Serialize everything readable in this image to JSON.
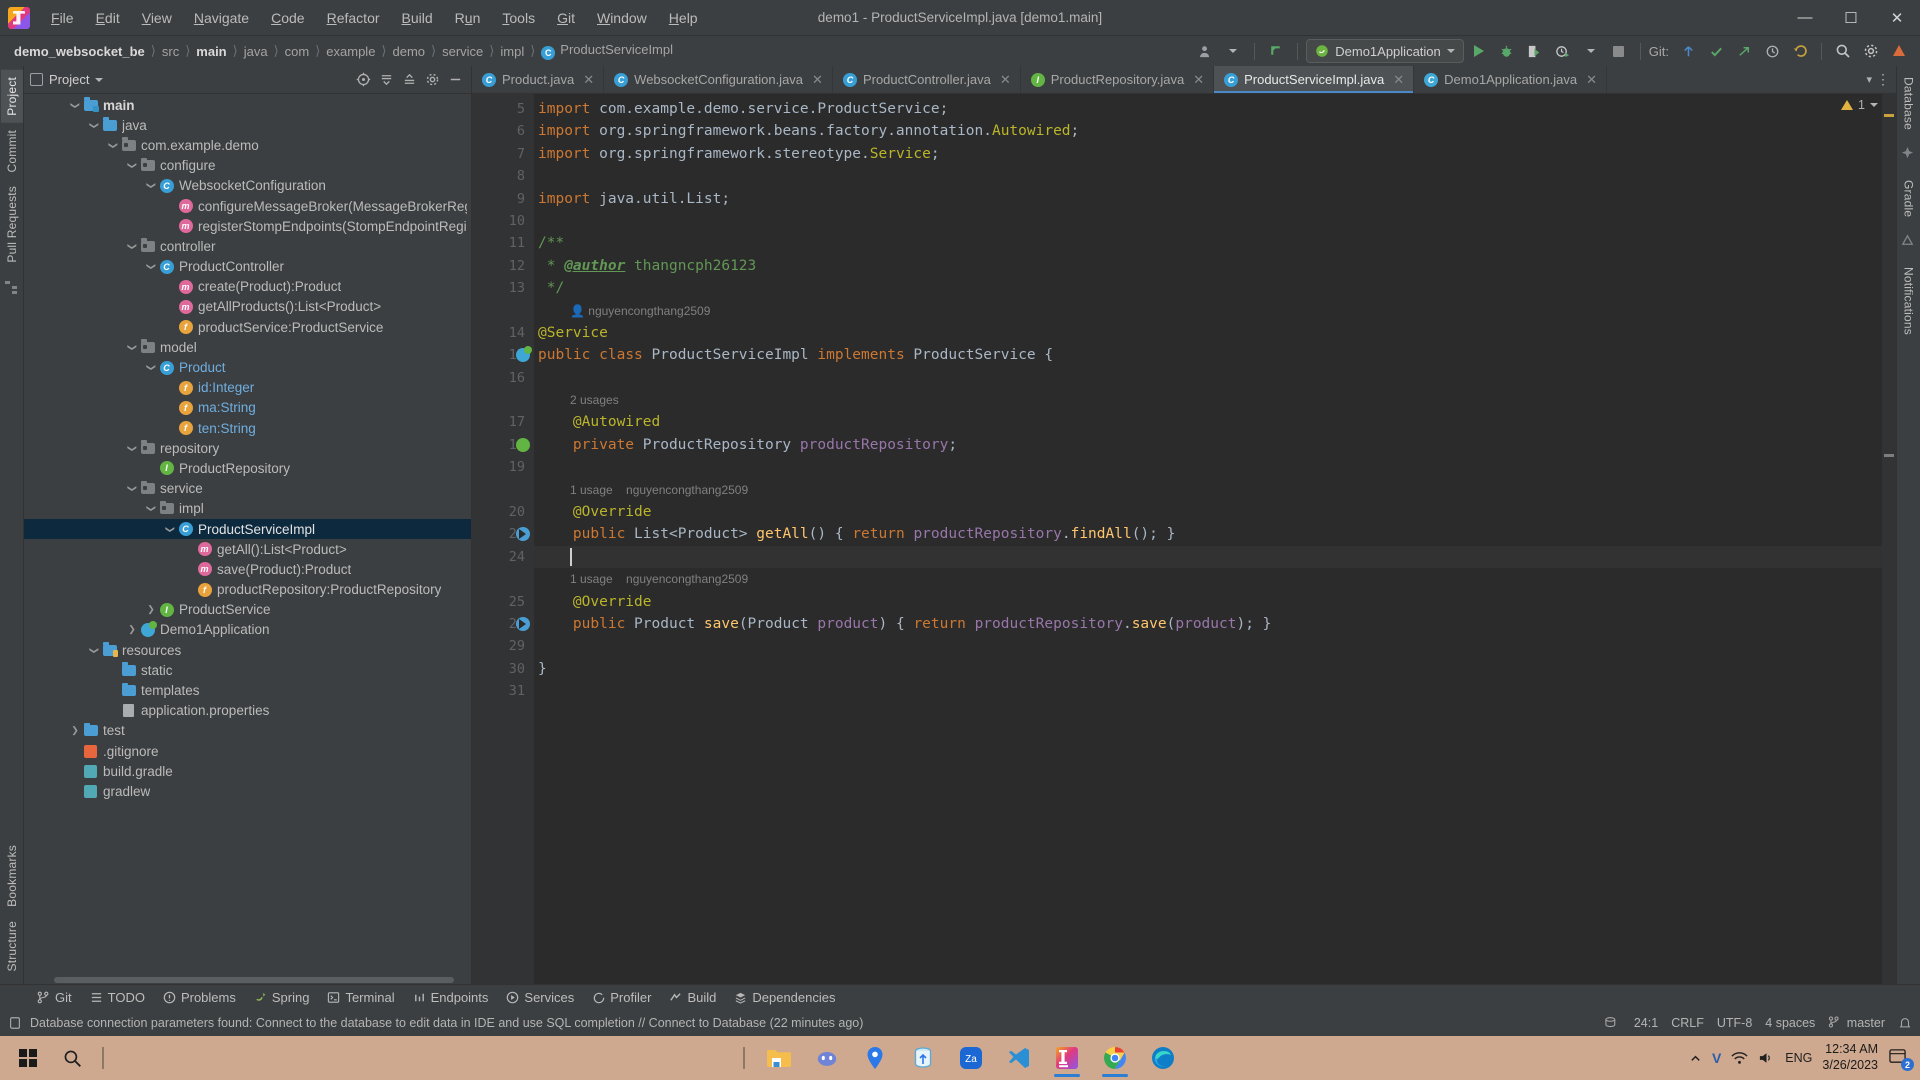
{
  "window": {
    "title": "demo1 - ProductServiceImpl.java [demo1.main]",
    "minimize_label": "—",
    "maximize_label": "❐",
    "close_label": "✕"
  },
  "menubar": [
    {
      "label": "File",
      "mnemonic": "F"
    },
    {
      "label": "Edit",
      "mnemonic": "E"
    },
    {
      "label": "View",
      "mnemonic": "V"
    },
    {
      "label": "Navigate",
      "mnemonic": "N"
    },
    {
      "label": "Code",
      "mnemonic": "C"
    },
    {
      "label": "Refactor",
      "mnemonic": "R"
    },
    {
      "label": "Build",
      "mnemonic": "B"
    },
    {
      "label": "Run",
      "mnemonic": "u"
    },
    {
      "label": "Tools",
      "mnemonic": "T"
    },
    {
      "label": "Git",
      "mnemonic": "G"
    },
    {
      "label": "Window",
      "mnemonic": "W"
    },
    {
      "label": "Help",
      "mnemonic": "H"
    }
  ],
  "breadcrumb": [
    {
      "label": "demo_websocket_be",
      "bold": true
    },
    {
      "label": "src",
      "bold": false
    },
    {
      "label": "main",
      "bold": true
    },
    {
      "label": "java",
      "bold": false
    },
    {
      "label": "com",
      "bold": false
    },
    {
      "label": "example",
      "bold": false
    },
    {
      "label": "demo",
      "bold": false
    },
    {
      "label": "service",
      "bold": false
    },
    {
      "label": "impl",
      "bold": false
    },
    {
      "label": "ProductServiceImpl",
      "bold": false,
      "icon": "C"
    }
  ],
  "toolbar": {
    "run_configuration": "Demo1Application",
    "git_label": "Git:",
    "run_button": "run-icon",
    "debug_button": "debug-icon",
    "coverage_button": "coverage-icon",
    "profile_button": "profile-icon",
    "stop_button": "stop-icon",
    "search_button": "search-icon",
    "settings_button": "settings-icon",
    "user_button": "user-icon",
    "updates_button": "update-icon"
  },
  "left_rail": {
    "tabs": [
      "Project",
      "Commit",
      "Pull Requests"
    ],
    "bottom_tabs": [
      "Bookmarks",
      "Structure"
    ],
    "active": "Project"
  },
  "right_rail": {
    "tabs": [
      "Database",
      "Gradle",
      "Notifications"
    ]
  },
  "project_panel": {
    "title": "Project",
    "tree": [
      {
        "indent": 2,
        "label": "main",
        "icon": "folder-src",
        "arrow": "down",
        "bold": true,
        "blue": false
      },
      {
        "indent": 3,
        "label": "java",
        "icon": "folder-blue",
        "arrow": "down",
        "bold": false,
        "blue": false
      },
      {
        "indent": 4,
        "label": "com.example.demo",
        "icon": "folder-pkg",
        "arrow": "down",
        "bold": false,
        "blue": false
      },
      {
        "indent": 5,
        "label": "configure",
        "icon": "folder-pkg",
        "arrow": "down",
        "bold": false,
        "blue": false
      },
      {
        "indent": 6,
        "label": "WebsocketConfiguration",
        "icon": "class",
        "arrow": "down",
        "bold": false,
        "blue": false
      },
      {
        "indent": 7,
        "label": "configureMessageBroker(MessageBrokerRegistry):v",
        "icon": "method",
        "arrow": "none",
        "bold": false,
        "blue": false
      },
      {
        "indent": 7,
        "label": "registerStompEndpoints(StompEndpointRegistry):v",
        "icon": "method",
        "arrow": "none",
        "bold": false,
        "blue": false
      },
      {
        "indent": 5,
        "label": "controller",
        "icon": "folder-pkg",
        "arrow": "down",
        "bold": false,
        "blue": false
      },
      {
        "indent": 6,
        "label": "ProductController",
        "icon": "class",
        "arrow": "down",
        "bold": false,
        "blue": false
      },
      {
        "indent": 7,
        "label": "create(Product):Product",
        "icon": "method",
        "arrow": "none",
        "bold": false,
        "blue": false
      },
      {
        "indent": 7,
        "label": "getAllProducts():List<Product>",
        "icon": "method",
        "arrow": "none",
        "bold": false,
        "blue": false
      },
      {
        "indent": 7,
        "label": "productService:ProductService",
        "icon": "field",
        "arrow": "none",
        "bold": false,
        "blue": false
      },
      {
        "indent": 5,
        "label": "model",
        "icon": "folder-pkg",
        "arrow": "down",
        "bold": false,
        "blue": false
      },
      {
        "indent": 6,
        "label": "Product",
        "icon": "class",
        "arrow": "down",
        "bold": false,
        "blue": true
      },
      {
        "indent": 7,
        "label": "id:Integer",
        "icon": "field",
        "arrow": "none",
        "bold": false,
        "blue": true
      },
      {
        "indent": 7,
        "label": "ma:String",
        "icon": "field",
        "arrow": "none",
        "bold": false,
        "blue": true
      },
      {
        "indent": 7,
        "label": "ten:String",
        "icon": "field",
        "arrow": "none",
        "bold": false,
        "blue": true
      },
      {
        "indent": 5,
        "label": "repository",
        "icon": "folder-pkg",
        "arrow": "down",
        "bold": false,
        "blue": false
      },
      {
        "indent": 6,
        "label": "ProductRepository",
        "icon": "interface",
        "arrow": "none",
        "bold": false,
        "blue": false
      },
      {
        "indent": 5,
        "label": "service",
        "icon": "folder-pkg",
        "arrow": "down",
        "bold": false,
        "blue": false
      },
      {
        "indent": 6,
        "label": "impl",
        "icon": "folder-pkg",
        "arrow": "down",
        "bold": false,
        "blue": false
      },
      {
        "indent": 7,
        "label": "ProductServiceImpl",
        "icon": "class",
        "arrow": "down",
        "bold": false,
        "blue": false,
        "selected": true
      },
      {
        "indent": 8,
        "label": "getAll():List<Product>",
        "icon": "method",
        "arrow": "none",
        "bold": false,
        "blue": false
      },
      {
        "indent": 8,
        "label": "save(Product):Product",
        "icon": "method",
        "arrow": "none",
        "bold": false,
        "blue": false
      },
      {
        "indent": 8,
        "label": "productRepository:ProductRepository",
        "icon": "field",
        "arrow": "none",
        "bold": false,
        "blue": false
      },
      {
        "indent": 6,
        "label": "ProductService",
        "icon": "interface",
        "arrow": "right",
        "bold": false,
        "blue": false
      },
      {
        "indent": 5,
        "label": "Demo1Application",
        "icon": "spring",
        "arrow": "right",
        "bold": false,
        "blue": false
      },
      {
        "indent": 3,
        "label": "resources",
        "icon": "folder-res",
        "arrow": "down",
        "bold": false,
        "blue": false
      },
      {
        "indent": 4,
        "label": "static",
        "icon": "folder-blue",
        "arrow": "none",
        "bold": false,
        "blue": false
      },
      {
        "indent": 4,
        "label": "templates",
        "icon": "folder-blue",
        "arrow": "none",
        "bold": false,
        "blue": false
      },
      {
        "indent": 4,
        "label": "application.properties",
        "icon": "props",
        "arrow": "none",
        "bold": false,
        "blue": false
      },
      {
        "indent": 2,
        "label": "test",
        "icon": "folder-test",
        "arrow": "right",
        "bold": false,
        "blue": false
      },
      {
        "indent": 2,
        "label": ".gitignore",
        "icon": "git",
        "arrow": "none",
        "bold": false,
        "blue": false
      },
      {
        "indent": 2,
        "label": "build.gradle",
        "icon": "gradle",
        "arrow": "none",
        "bold": false,
        "blue": false
      },
      {
        "indent": 2,
        "label": "gradlew",
        "icon": "gradle",
        "arrow": "none",
        "bold": false,
        "blue": false
      }
    ]
  },
  "editor_tabs": [
    {
      "label": "Product.java",
      "icon": "class",
      "active": false
    },
    {
      "label": "WebsocketConfiguration.java",
      "icon": "class",
      "active": false
    },
    {
      "label": "ProductController.java",
      "icon": "class",
      "active": false
    },
    {
      "label": "ProductRepository.java",
      "icon": "interface",
      "active": false
    },
    {
      "label": "ProductServiceImpl.java",
      "icon": "class",
      "active": true
    },
    {
      "label": "Demo1Application.java",
      "icon": "spring",
      "active": false
    }
  ],
  "editor": {
    "filename": "ProductServiceImpl.java",
    "inspection_count": "1",
    "lines": [
      {
        "num": "5",
        "type": "code",
        "text": "import com.example.demo.service.ProductService;"
      },
      {
        "num": "6",
        "type": "code",
        "text": "import org.springframework.beans.factory.annotation.Autowired;"
      },
      {
        "num": "7",
        "type": "code",
        "text": "import org.springframework.stereotype.Service;"
      },
      {
        "num": "8",
        "type": "code",
        "text": ""
      },
      {
        "num": "9",
        "type": "code",
        "text": "import java.util.List;"
      },
      {
        "num": "10",
        "type": "code",
        "text": ""
      },
      {
        "num": "11",
        "type": "code",
        "text": "/**"
      },
      {
        "num": "12",
        "type": "code",
        "text": " * @author thangncph26123"
      },
      {
        "num": "13",
        "type": "code",
        "text": " */"
      },
      {
        "num": "",
        "type": "hint",
        "text": "nguyencongthang2509"
      },
      {
        "num": "14",
        "type": "code",
        "text": "@Service"
      },
      {
        "num": "15",
        "type": "code",
        "text": "public class ProductServiceImpl implements ProductService {"
      },
      {
        "num": "16",
        "type": "code",
        "text": ""
      },
      {
        "num": "",
        "type": "hint",
        "text": "2 usages"
      },
      {
        "num": "17",
        "type": "code",
        "text": "    @Autowired"
      },
      {
        "num": "18",
        "type": "code",
        "text": "    private ProductRepository productRepository;"
      },
      {
        "num": "19",
        "type": "code",
        "text": ""
      },
      {
        "num": "",
        "type": "hint",
        "text": "1 usage    nguyencongthang2509"
      },
      {
        "num": "20",
        "type": "code",
        "text": "    @Override"
      },
      {
        "num": "21",
        "type": "code",
        "text": "    public List<Product> getAll() { return productRepository.findAll(); }"
      },
      {
        "num": "24",
        "type": "code",
        "text": ""
      },
      {
        "num": "",
        "type": "hint",
        "text": "1 usage    nguyencongthang2509"
      },
      {
        "num": "25",
        "type": "code",
        "text": "    @Override"
      },
      {
        "num": "26",
        "type": "code",
        "text": "    public Product save(Product product) { return productRepository.save(product); }"
      },
      {
        "num": "29",
        "type": "code",
        "text": ""
      },
      {
        "num": "30",
        "type": "code",
        "text": "}"
      },
      {
        "num": "31",
        "type": "code",
        "text": ""
      }
    ],
    "hints": {
      "usages_2": "2 usages",
      "usages_1": "1 usage",
      "author_vcs": "nguyencongthang2509"
    }
  },
  "bottom_toolwindows": [
    {
      "label": "Git",
      "icon": "git-icon"
    },
    {
      "label": "TODO",
      "icon": "todo-icon"
    },
    {
      "label": "Problems",
      "icon": "problems-icon"
    },
    {
      "label": "Spring",
      "icon": "spring-icon"
    },
    {
      "label": "Terminal",
      "icon": "terminal-icon"
    },
    {
      "label": "Endpoints",
      "icon": "endpoints-icon"
    },
    {
      "label": "Services",
      "icon": "services-icon"
    },
    {
      "label": "Profiler",
      "icon": "profiler-icon"
    },
    {
      "label": "Build",
      "icon": "build-icon"
    },
    {
      "label": "Dependencies",
      "icon": "dependencies-icon"
    }
  ],
  "statusbar": {
    "message": "Database connection parameters found: Connect to the database to edit data in IDE and use SQL completion // Connect to Database (22 minutes ago)",
    "caret": "24:1",
    "line_separator": "CRLF",
    "encoding": "UTF-8",
    "indent": "4 spaces",
    "branch": "master"
  },
  "taskbar": {
    "start": "windows-start-icon",
    "search": "search-icon",
    "apps": [
      {
        "name": "file-explorer-icon",
        "active": false
      },
      {
        "name": "discord-icon",
        "active": false
      },
      {
        "name": "location-icon",
        "active": false
      },
      {
        "name": "database-icon",
        "active": false
      },
      {
        "name": "zalo-icon",
        "active": false
      },
      {
        "name": "vscode-icon",
        "active": false
      },
      {
        "name": "intellij-idea-icon",
        "active": true
      },
      {
        "name": "chrome-icon",
        "active": true
      },
      {
        "name": "edge-icon",
        "active": false
      }
    ],
    "tray": {
      "chevron": "show-hidden-icons",
      "vpn": "V",
      "network": "network-icon",
      "volume": "volume-icon",
      "language": "ENG",
      "time": "12:34 AM",
      "date": "3/26/2023",
      "notification_count": "2"
    }
  }
}
